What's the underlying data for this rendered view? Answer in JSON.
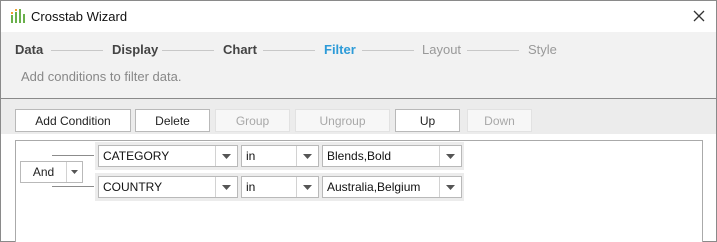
{
  "window": {
    "title": "Crosstab Wizard"
  },
  "steps": [
    {
      "label": "Data",
      "state": "done"
    },
    {
      "label": "Display",
      "state": "done"
    },
    {
      "label": "Chart",
      "state": "done"
    },
    {
      "label": "Filter",
      "state": "active"
    },
    {
      "label": "Layout",
      "state": "pending"
    },
    {
      "label": "Style",
      "state": "pending"
    }
  ],
  "step_description": "Add conditions to filter data.",
  "toolbar": {
    "add_condition": "Add Condition",
    "delete": "Delete",
    "group": "Group",
    "ungroup": "Ungroup",
    "up": "Up",
    "down": "Down"
  },
  "logic_operator": "And",
  "conditions": [
    {
      "field": "CATEGORY",
      "operator": "in",
      "value": "Blends,Bold"
    },
    {
      "field": "COUNTRY",
      "operator": "in",
      "value": "Australia,Belgium"
    }
  ],
  "colors": {
    "active_step": "#2d9bd8",
    "logo_green": "#6ab04c",
    "logo_orange": "#f0a030"
  },
  "icons": {
    "app": "crosstab-wizard-icon",
    "close": "close-icon",
    "dropdown": "dropdown-arrow-icon"
  }
}
